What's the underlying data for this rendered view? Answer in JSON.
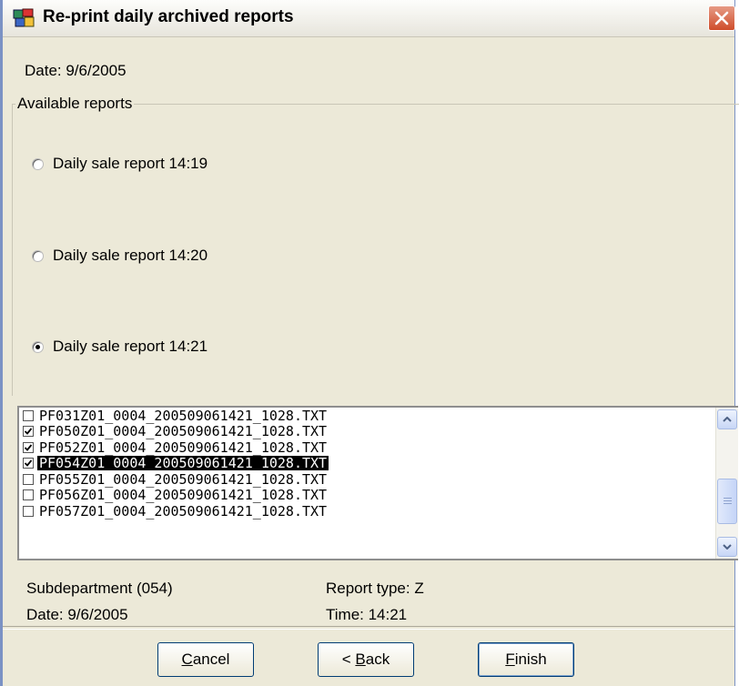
{
  "window": {
    "title": "Re-print daily archived reports",
    "icon": "report-print-icon",
    "close_icon": "close-icon"
  },
  "header": {
    "date_label": "Date: 9/6/2005"
  },
  "available_reports": {
    "group_label": "Available reports",
    "options": [
      {
        "label": "Daily sale report 14:19",
        "selected": false
      },
      {
        "label": "Daily sale report 14:20",
        "selected": false
      },
      {
        "label": "Daily sale report 14:21",
        "selected": true
      }
    ]
  },
  "files": {
    "rows": [
      {
        "name": "PF031Z01_0004_200509061421_1028.TXT",
        "checked": false,
        "highlighted": false
      },
      {
        "name": "PF050Z01_0004_200509061421_1028.TXT",
        "checked": true,
        "highlighted": false
      },
      {
        "name": "PF052Z01_0004_200509061421_1028.TXT",
        "checked": true,
        "highlighted": false
      },
      {
        "name": "PF054Z01_0004_200509061421_1028.TXT",
        "checked": true,
        "highlighted": true
      },
      {
        "name": "PF055Z01_0004_200509061421_1028.TXT",
        "checked": false,
        "highlighted": false
      },
      {
        "name": "PF056Z01_0004_200509061421_1028.TXT",
        "checked": false,
        "highlighted": false
      },
      {
        "name": "PF057Z01_0004_200509061421_1028.TXT",
        "checked": false,
        "highlighted": false
      }
    ]
  },
  "details": {
    "subdepartment": "Subdepartment (054)",
    "report_type": "Report type: Z",
    "date": "Date: 9/6/2005",
    "time": "Time: 14:21"
  },
  "buttons": {
    "cancel": {
      "underlined": "C",
      "rest": "ancel"
    },
    "back": {
      "prefix": "< ",
      "underlined": "B",
      "rest": "ack"
    },
    "finish": {
      "underlined": "F",
      "rest": "inish"
    }
  },
  "colors": {
    "window_bg": "#ece9d8",
    "selection": "#000000",
    "close_button": "#cf4d2b"
  }
}
